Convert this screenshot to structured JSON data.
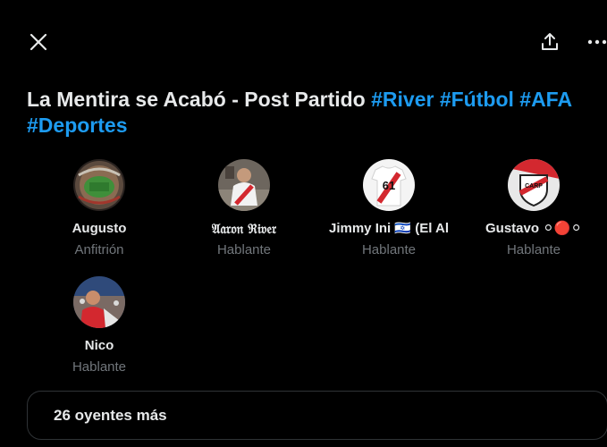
{
  "space": {
    "title_text": "La Mentira se Acabó - Post Partido",
    "hashtags": [
      "#River",
      "#Fútbol",
      "#AFA",
      "#Deportes"
    ]
  },
  "toolbar": {
    "close_icon": "close-icon",
    "share_icon": "share-icon",
    "more_icon": "more-icon"
  },
  "participants": [
    {
      "name": "Augusto",
      "role": "Anfitrión",
      "avatar": "stadium"
    },
    {
      "name": "𝔄𝔞𝔯𝔬𝔫 ℜ𝔦𝔳𝔢𝔯",
      "role": "Hablante",
      "avatar": "player"
    },
    {
      "name": "Jimmy Ini 🇮🇱 (El Al",
      "role": "Hablante",
      "avatar": "jersey"
    },
    {
      "name": "Gustavo ⚪🔴⚪",
      "role": "Hablante",
      "avatar": "crest"
    },
    {
      "name": "Nico",
      "role": "Hablante",
      "avatar": "crowd"
    }
  ],
  "listeners": {
    "label": "26 oyentes más"
  },
  "colors": {
    "background": "#000000",
    "text": "#e7e9ea",
    "secondary": "#71767b",
    "accent": "#1d9bf0",
    "border": "#2f3336"
  }
}
